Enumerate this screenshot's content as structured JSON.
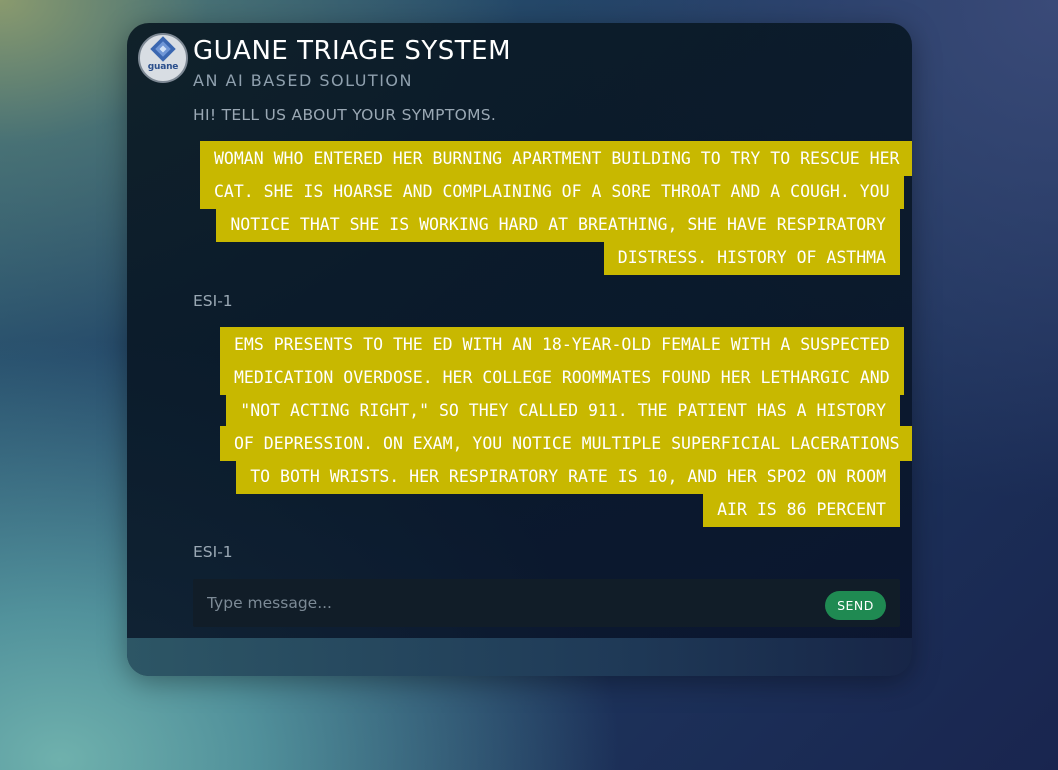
{
  "header": {
    "logo_text": "guane",
    "title": "GUANE TRIAGE SYSTEM",
    "subtitle": "AN AI BASED SOLUTION"
  },
  "chat": {
    "greeting": "HI! TELL US ABOUT YOUR SYMPTOMS.",
    "messages": [
      {
        "role": "user",
        "text": "WOMAN WHO ENTERED HER BURNING APARTMENT BUILDING TO TRY TO RESCUE HER CAT. SHE IS HOARSE AND COMPLAINING OF A SORE THROAT AND A COUGH. YOU NOTICE THAT SHE IS WORKING HARD AT BREATHING, SHE HAVE RESPIRATORY DISTRESS. HISTORY OF ASTHMA"
      },
      {
        "role": "bot",
        "text": "ESI-1"
      },
      {
        "role": "user",
        "text": "EMS PRESENTS TO THE ED WITH AN 18-YEAR-OLD FEMALE WITH A SUSPECTED MEDICATION OVERDOSE. HER COLLEGE ROOMMATES FOUND HER LETHARGIC AND \"NOT ACTING RIGHT,\" SO THEY CALLED 911. THE PATIENT HAS A HISTORY OF DEPRESSION. ON EXAM, YOU NOTICE MULTIPLE SUPERFICIAL LACERATIONS TO BOTH WRISTS. HER RESPIRATORY RATE IS 10, AND HER SPO2 ON ROOM AIR IS 86 PERCENT"
      },
      {
        "role": "bot",
        "text": "ESI-1"
      }
    ]
  },
  "composer": {
    "placeholder": "Type message...",
    "value": "",
    "send_label": "SEND"
  },
  "colors": {
    "user_bubble": "#c8b800",
    "send_button": "#1f8a52"
  },
  "icons": {
    "logo": "guane-logo-icon"
  }
}
